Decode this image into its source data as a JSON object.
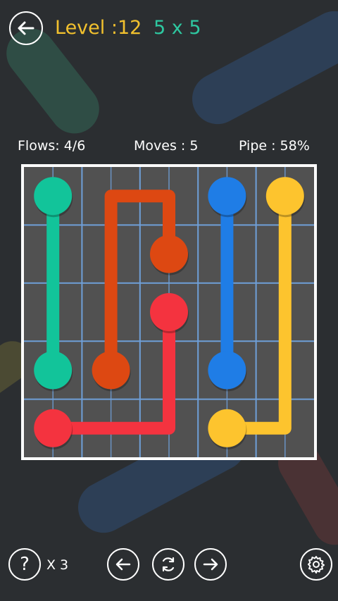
{
  "header": {
    "back_icon": "arrow-left-icon",
    "level_text": "Level :12",
    "size_text": "5 x 5",
    "level_color": "#f2c12e",
    "size_color": "#2ec7a0"
  },
  "stats": {
    "flows": "Flows: 4/6",
    "moves": "Moves : 5",
    "pipe": "Pipe : 58%"
  },
  "board": {
    "rows": 5,
    "cols": 5,
    "grid_color": "#6f9fd8",
    "cell_color": "#515151",
    "flows": [
      {
        "color_name": "green",
        "color": "#12c49a",
        "path": [
          [
            0,
            0
          ],
          [
            1,
            0
          ],
          [
            2,
            0
          ],
          [
            3,
            0
          ]
        ]
      },
      {
        "color_name": "orange",
        "color": "#dd4812",
        "path": [
          [
            3,
            1
          ],
          [
            2,
            1
          ],
          [
            1,
            1
          ],
          [
            0,
            1
          ],
          [
            0,
            2
          ],
          [
            1,
            2
          ]
        ]
      },
      {
        "color_name": "blue",
        "color": "#1f7de6",
        "path": [
          [
            0,
            3
          ],
          [
            1,
            3
          ],
          [
            2,
            3
          ],
          [
            3,
            3
          ]
        ]
      },
      {
        "color_name": "yellow",
        "color": "#fdc42e",
        "path": [
          [
            0,
            4
          ],
          [
            1,
            4
          ],
          [
            2,
            4
          ],
          [
            3,
            4
          ],
          [
            4,
            4
          ],
          [
            4,
            3
          ]
        ]
      },
      {
        "color_name": "red",
        "color": "#f4333f",
        "path": [
          [
            4,
            0
          ],
          [
            4,
            1
          ],
          [
            4,
            2
          ],
          [
            3,
            2
          ],
          [
            2,
            2
          ]
        ]
      }
    ]
  },
  "footer": {
    "hint_icon": "question-icon",
    "hint_count": "X 3",
    "prev_icon": "arrow-left-icon",
    "reset_icon": "refresh-icon",
    "next_icon": "arrow-right-icon",
    "settings_icon": "gear-icon"
  }
}
